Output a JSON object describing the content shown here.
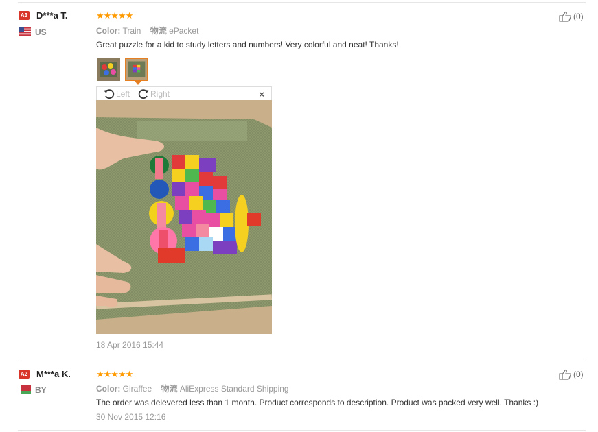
{
  "reviews": [
    {
      "level": "A3",
      "name": "D***a T.",
      "country": "US",
      "stars": "★★★★★",
      "color_label": "Color:",
      "color_value": "Train",
      "logistics_label": "物流",
      "logistics_value": "ePacket",
      "text": "Great puzzle for a kid to study letters and numbers! Very colorful and neat! Thanks!",
      "date": "18 Apr 2016 15:44",
      "helpful": "(0)",
      "rating": 5
    },
    {
      "level": "A2",
      "name": "M***a K.",
      "country": "BY",
      "stars": "★★★★★",
      "color_label": "Color:",
      "color_value": "Giraffee",
      "logistics_label": "物流",
      "logistics_value": "AliExpress Standard Shipping",
      "text": "The order was delevered less than 1 month. Product corresponds to description. Product was packed very well. Thanks :)",
      "date": "30 Nov 2015 12:16",
      "helpful": "(0)",
      "rating": 5
    }
  ],
  "viewer": {
    "rotate_left": "Left",
    "rotate_right": "Right",
    "close": "×"
  },
  "icons": {
    "thumb": "thumbs-up-icon",
    "rotate_left": "rotate-left-icon",
    "rotate_right": "rotate-right-icon",
    "close": "close-icon"
  },
  "colors": {
    "star": "#ff9a00",
    "badge": "#d9362b",
    "selected": "#e67e22"
  }
}
